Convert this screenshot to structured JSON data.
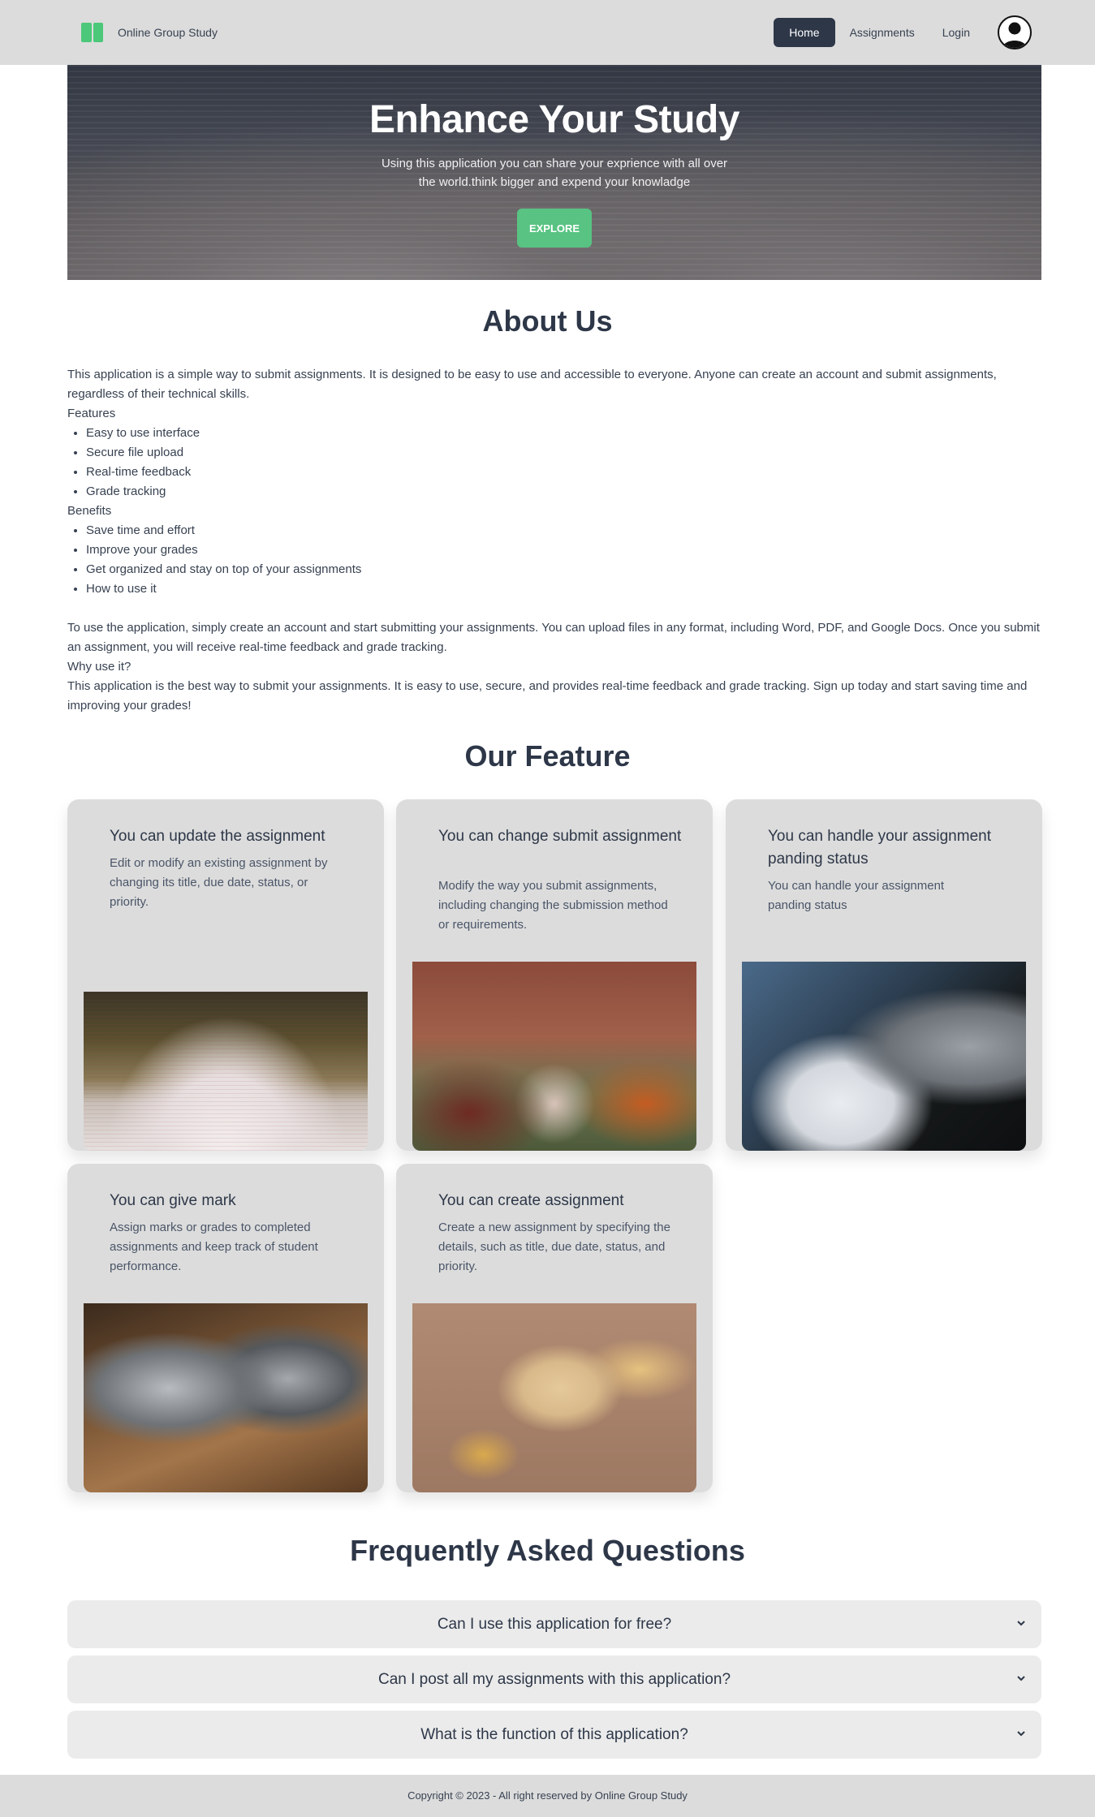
{
  "nav": {
    "brand": "Online Group Study",
    "links": [
      "Home",
      "Assignments",
      "Login"
    ],
    "active": "Home"
  },
  "hero": {
    "title": "Enhance Your Study",
    "subtitle": "Using this application you can share your exprience with all over the world.think bigger and expend your knowladge",
    "button": "EXPLORE"
  },
  "about": {
    "title": "About Us",
    "intro": "This application is a simple way to submit assignments. It is designed to be easy to use and accessible to everyone. Anyone can create an account and submit assignments, regardless of their technical skills.",
    "features_heading": "Features",
    "features": [
      "Easy to use interface",
      "Secure file upload",
      "Real-time feedback",
      "Grade tracking"
    ],
    "benefits_heading": "Benefits",
    "benefits": [
      "Save time and effort",
      "Improve your grades",
      "Get organized and stay on top of your assignments",
      "How to use it"
    ],
    "how_to": "To use the application, simply create an account and start submitting your assignments. You can upload files in any format, including Word, PDF, and Google Docs. Once you submit an assignment, you will receive real-time feedback and grade tracking.",
    "why_heading": "Why use it?",
    "why": "This application is the best way to submit your assignments. It is easy to use, secure, and provides real-time feedback and grade tracking. Sign up today and start saving time and improving your grades!"
  },
  "features": {
    "title": "Our Feature",
    "cards": [
      {
        "title": "You can update the assignment",
        "text": "Edit or modify an existing assignment by changing its title, due date, status, or priority."
      },
      {
        "title": "You can change submit assignment",
        "text": "Modify the way you submit assignments, including changing the submission method or requirements."
      },
      {
        "title": "You can handle your assignment panding status",
        "text": "You can handle your assignment panding status"
      },
      {
        "title": "You can give mark",
        "text": "Assign marks or grades to completed assignments and keep track of student performance."
      },
      {
        "title": "You can create assignment",
        "text": "Create a new assignment by specifying the details, such as title, due date, status, and priority."
      }
    ]
  },
  "faq": {
    "title": "Frequently Asked Questions",
    "questions": [
      "Can I use this application for free?",
      "Can I post all my assignments with this application?",
      "What is the function of this application?"
    ]
  },
  "footer": {
    "text": "Copyright © 2023 - All right reserved by Online Group Study"
  },
  "colors": {
    "navbar": "#dcdcdc",
    "accent_green": "#58c382",
    "active_nav": "#2d3748",
    "card": "#dcdcdc",
    "faq": "#ebebeb"
  }
}
